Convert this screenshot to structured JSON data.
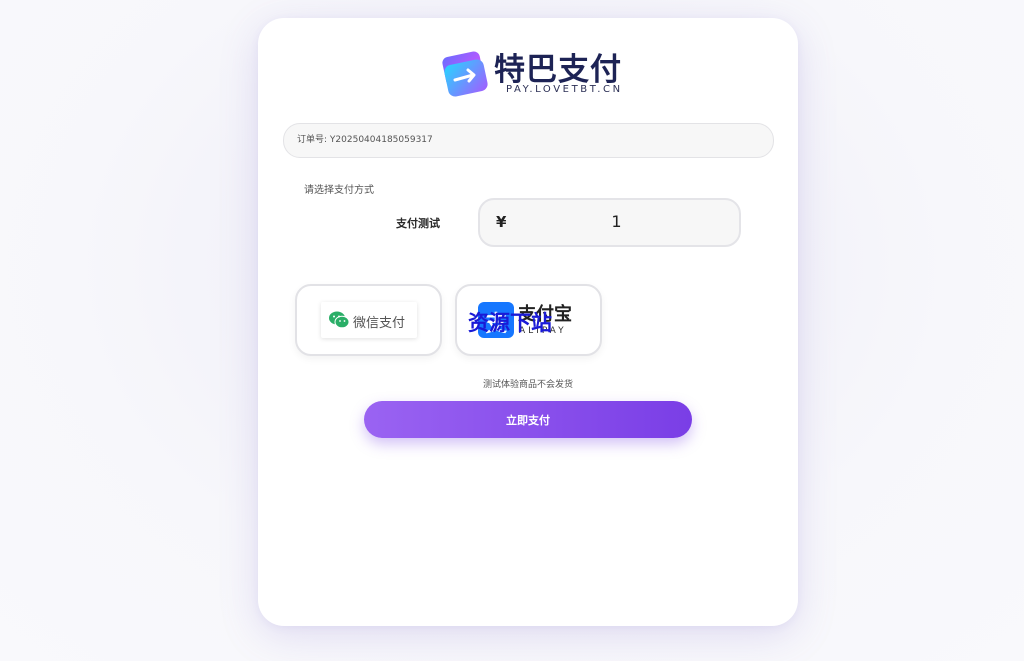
{
  "brand": {
    "title": "特巴支付",
    "subtitle": "PAY.LOVETBT.CN"
  },
  "order": {
    "label": "订单号:",
    "number": "Y20250404185059317"
  },
  "payment": {
    "prompt": "请选择支付方式",
    "product_name": "支付测试",
    "currency_symbol": "¥",
    "amount": "1"
  },
  "methods": {
    "wechat": {
      "label": "微信支付",
      "icon": "wechat-icon",
      "color": "#2aae67"
    },
    "alipay": {
      "name": "支付宝",
      "sub": "ALIPAY",
      "icon_char": "支",
      "icon": "alipay-icon",
      "color": "#1677ff"
    }
  },
  "watermark": "资源下站",
  "notice": "测试体验商品不会发货",
  "submit_label": "立即支付",
  "colors": {
    "accent_start": "#9a63f2",
    "accent_end": "#7a3ee6",
    "brand_text": "#1d2355"
  }
}
